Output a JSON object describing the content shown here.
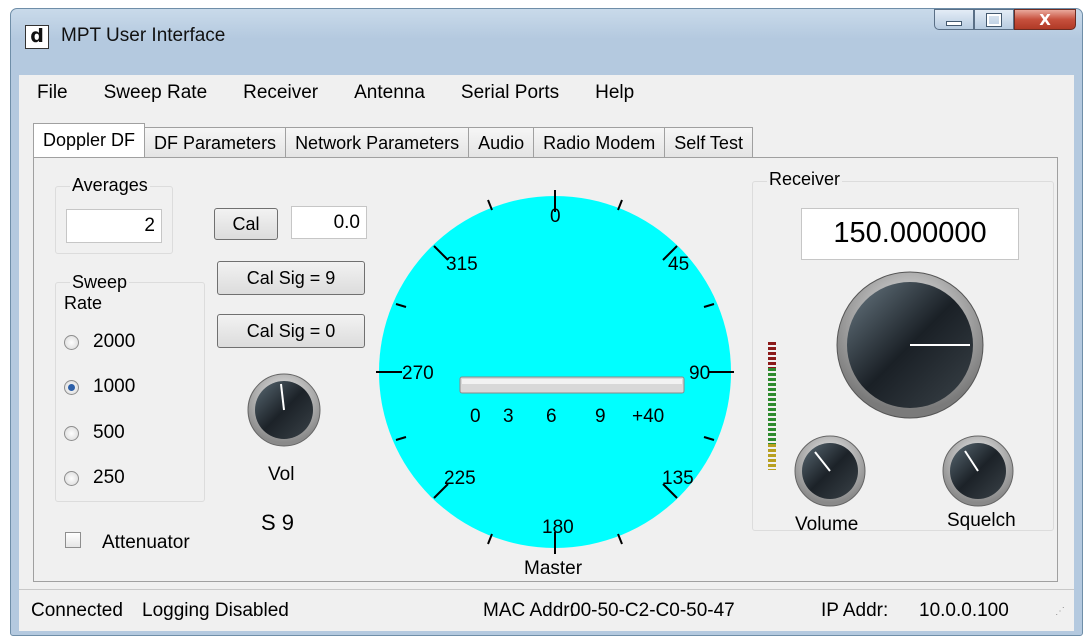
{
  "window": {
    "title": "MPT User Interface",
    "icon": "d",
    "close_glyph": "X"
  },
  "menu": [
    "File",
    "Sweep Rate",
    "Receiver",
    "Antenna",
    "Serial Ports",
    "Help"
  ],
  "tabs": [
    "Doppler DF",
    "DF Parameters",
    "Network Parameters",
    "Audio",
    "Radio Modem",
    "Self Test"
  ],
  "averages": {
    "label": "Averages",
    "value": "2"
  },
  "cal": {
    "button": "Cal",
    "value": "0.0",
    "cal_sig_9": "Cal Sig = 9",
    "cal_sig_0": "Cal Sig = 0"
  },
  "sweep": {
    "label_line1": "Sweep",
    "label_line2": "Rate",
    "options": [
      "2000",
      "1000",
      "500",
      "250"
    ],
    "selected": "1000"
  },
  "vol": {
    "label": "Vol",
    "signal": "S 9"
  },
  "attenuator": {
    "label": "Attenuator",
    "checked": false
  },
  "compass": {
    "color": "#00ffff",
    "labels": {
      "n": "0",
      "ne": "45",
      "e": "90",
      "se": "135",
      "s": "180",
      "sw": "225",
      "w": "270",
      "nw": "315"
    },
    "scale": [
      "0",
      "3",
      "6",
      "9",
      "+40"
    ],
    "caption": "Master"
  },
  "receiver": {
    "label": "Receiver",
    "frequency": "150.000000",
    "volume_label": "Volume",
    "squelch_label": "Squelch"
  },
  "status": {
    "connection": "Connected",
    "logging": "Logging Disabled",
    "mac_label": "MAC Addr:",
    "mac": "00-50-C2-C0-50-47",
    "ip_label": "IP Addr:",
    "ip": "10.0.0.100"
  }
}
